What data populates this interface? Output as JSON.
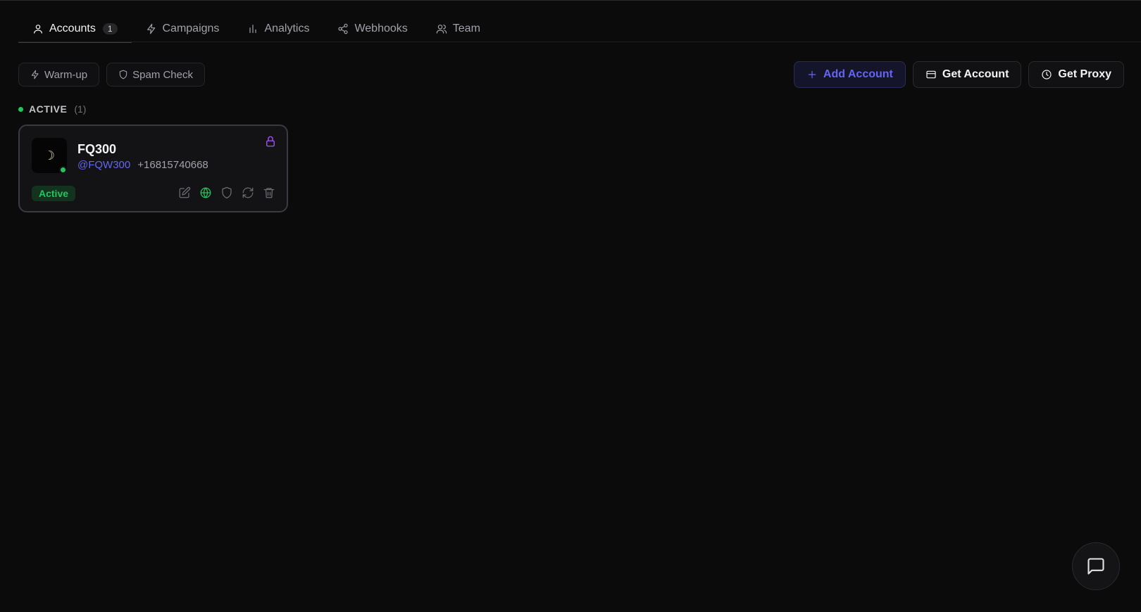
{
  "tabs": [
    {
      "label": "Accounts",
      "badge": "1",
      "icon": "user-icon",
      "active": true
    },
    {
      "label": "Campaigns",
      "icon": "bolt-icon"
    },
    {
      "label": "Analytics",
      "icon": "bar-chart-icon"
    },
    {
      "label": "Webhooks",
      "icon": "share-icon"
    },
    {
      "label": "Team",
      "icon": "users-icon"
    }
  ],
  "toolbar": {
    "warmup_label": "Warm-up",
    "spam_check_label": "Spam Check",
    "add_account_label": "Add Account",
    "get_account_label": "Get Account",
    "get_proxy_label": "Get Proxy"
  },
  "section": {
    "title": "ACTIVE",
    "count": "(1)"
  },
  "account": {
    "name": "FQ300",
    "handle": "@FQW300",
    "phone": "+16815740668",
    "avatar_glyph": "☽",
    "status": "Active"
  },
  "colors": {
    "accent": "#6366f1",
    "active_green": "#22c55e",
    "lock_purple": "#a855f7",
    "background": "#0b0b0b"
  }
}
